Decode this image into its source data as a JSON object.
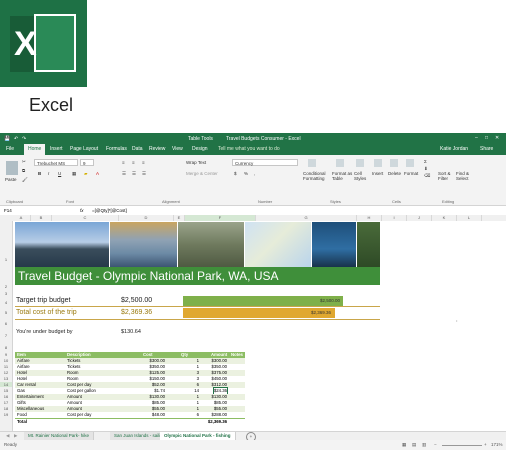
{
  "logo": {
    "letter": "X",
    "label": "Excel"
  },
  "window": {
    "title": "Travel Budgets Consumer - Excel",
    "context_tab": "Table Tools",
    "tell_me": "Tell me what you want to do",
    "user": "Katie Jordan",
    "share": "Share",
    "tabs": [
      "File",
      "Home",
      "Insert",
      "Page Layout",
      "Formulas",
      "Data",
      "Review",
      "View",
      "Design"
    ]
  },
  "ribbon": {
    "paste": "Paste",
    "font_name": "Trebuchet MS",
    "font_size": "9",
    "wrap_text": "Wrap Text",
    "merge_center": "Merge & Center",
    "number_format": "Currency",
    "conditional_formatting": "Conditional Formatting",
    "format_as_table": "Format as Table",
    "cell_styles": "Cell Styles",
    "insert": "Insert",
    "delete": "Delete",
    "format": "Format",
    "sort_filter": "Sort & Filter",
    "find_select": "Find & Select",
    "groups": [
      "Clipboard",
      "Font",
      "Alignment",
      "Number",
      "Styles",
      "Cells",
      "Editing"
    ]
  },
  "formula_bar": {
    "name_box": "F14",
    "fx": "fx",
    "formula": "=[@Qty]*[@Cost]"
  },
  "columns": [
    "A",
    "B",
    "C",
    "D",
    "E",
    "F",
    "G",
    "H",
    "I",
    "J",
    "K",
    "L"
  ],
  "rows": [
    "1",
    "2",
    "3",
    "4",
    "5",
    "6",
    "7",
    "8",
    "9",
    "10",
    "11",
    "12",
    "13",
    "14",
    "15",
    "16",
    "17",
    "18",
    "19"
  ],
  "banner_title": "Travel Budget - Olympic National Park, WA, USA",
  "summary": {
    "target_label": "Target trip budget",
    "target_value": "$2,500.00",
    "target_bar_text": "$2,500.00",
    "target_bar_fraction": 1.0,
    "total_label": "Total cost of the trip",
    "total_value": "$2,369.36",
    "total_bar_text": "$2,369.36",
    "total_bar_fraction": 0.948,
    "under_label": "You're under budget by",
    "under_value": "$130.64"
  },
  "table": {
    "headers": [
      "Item",
      "Description",
      "Cost",
      "Qty",
      "Amount",
      "Notes"
    ],
    "rows": [
      [
        "Airfare",
        "Tickets",
        "$300.00",
        "1",
        "$300.00"
      ],
      [
        "Airfare",
        "Tickets",
        "$350.00",
        "1",
        "$350.00"
      ],
      [
        "Hotel",
        "Room",
        "$125.00",
        "3",
        "$375.00"
      ],
      [
        "Hotel",
        "Room",
        "$150.00",
        "3",
        "$450.00"
      ],
      [
        "Car rental",
        "Cost per day",
        "$52.00",
        "6",
        "$312.00"
      ],
      [
        "Gas",
        "Cost per gallon",
        "$1.74",
        "14",
        "$24.36"
      ],
      [
        "Entertainment",
        "Amount",
        "$130.00",
        "1",
        "$130.00"
      ],
      [
        "Gifts",
        "Amount",
        "$85.00",
        "1",
        "$85.00"
      ],
      [
        "Miscellaneous",
        "Amount",
        "$55.00",
        "1",
        "$55.00"
      ],
      [
        "Food",
        "Cost per day",
        "$48.00",
        "6",
        "$288.00"
      ]
    ],
    "total_label": "Total",
    "total_value": "$2,369.36"
  },
  "sheet_tabs": [
    "Mt. Rainier National Park- hike",
    "San Juan Islands - sailing",
    "Olympic National Park - fishing"
  ],
  "status": {
    "ready": "Ready",
    "zoom": "171%"
  },
  "colors": {
    "excel_green": "#217346",
    "banner": "#3f8f3a",
    "target_bar": "#7fb04a",
    "total_bar": "#e0a830"
  }
}
